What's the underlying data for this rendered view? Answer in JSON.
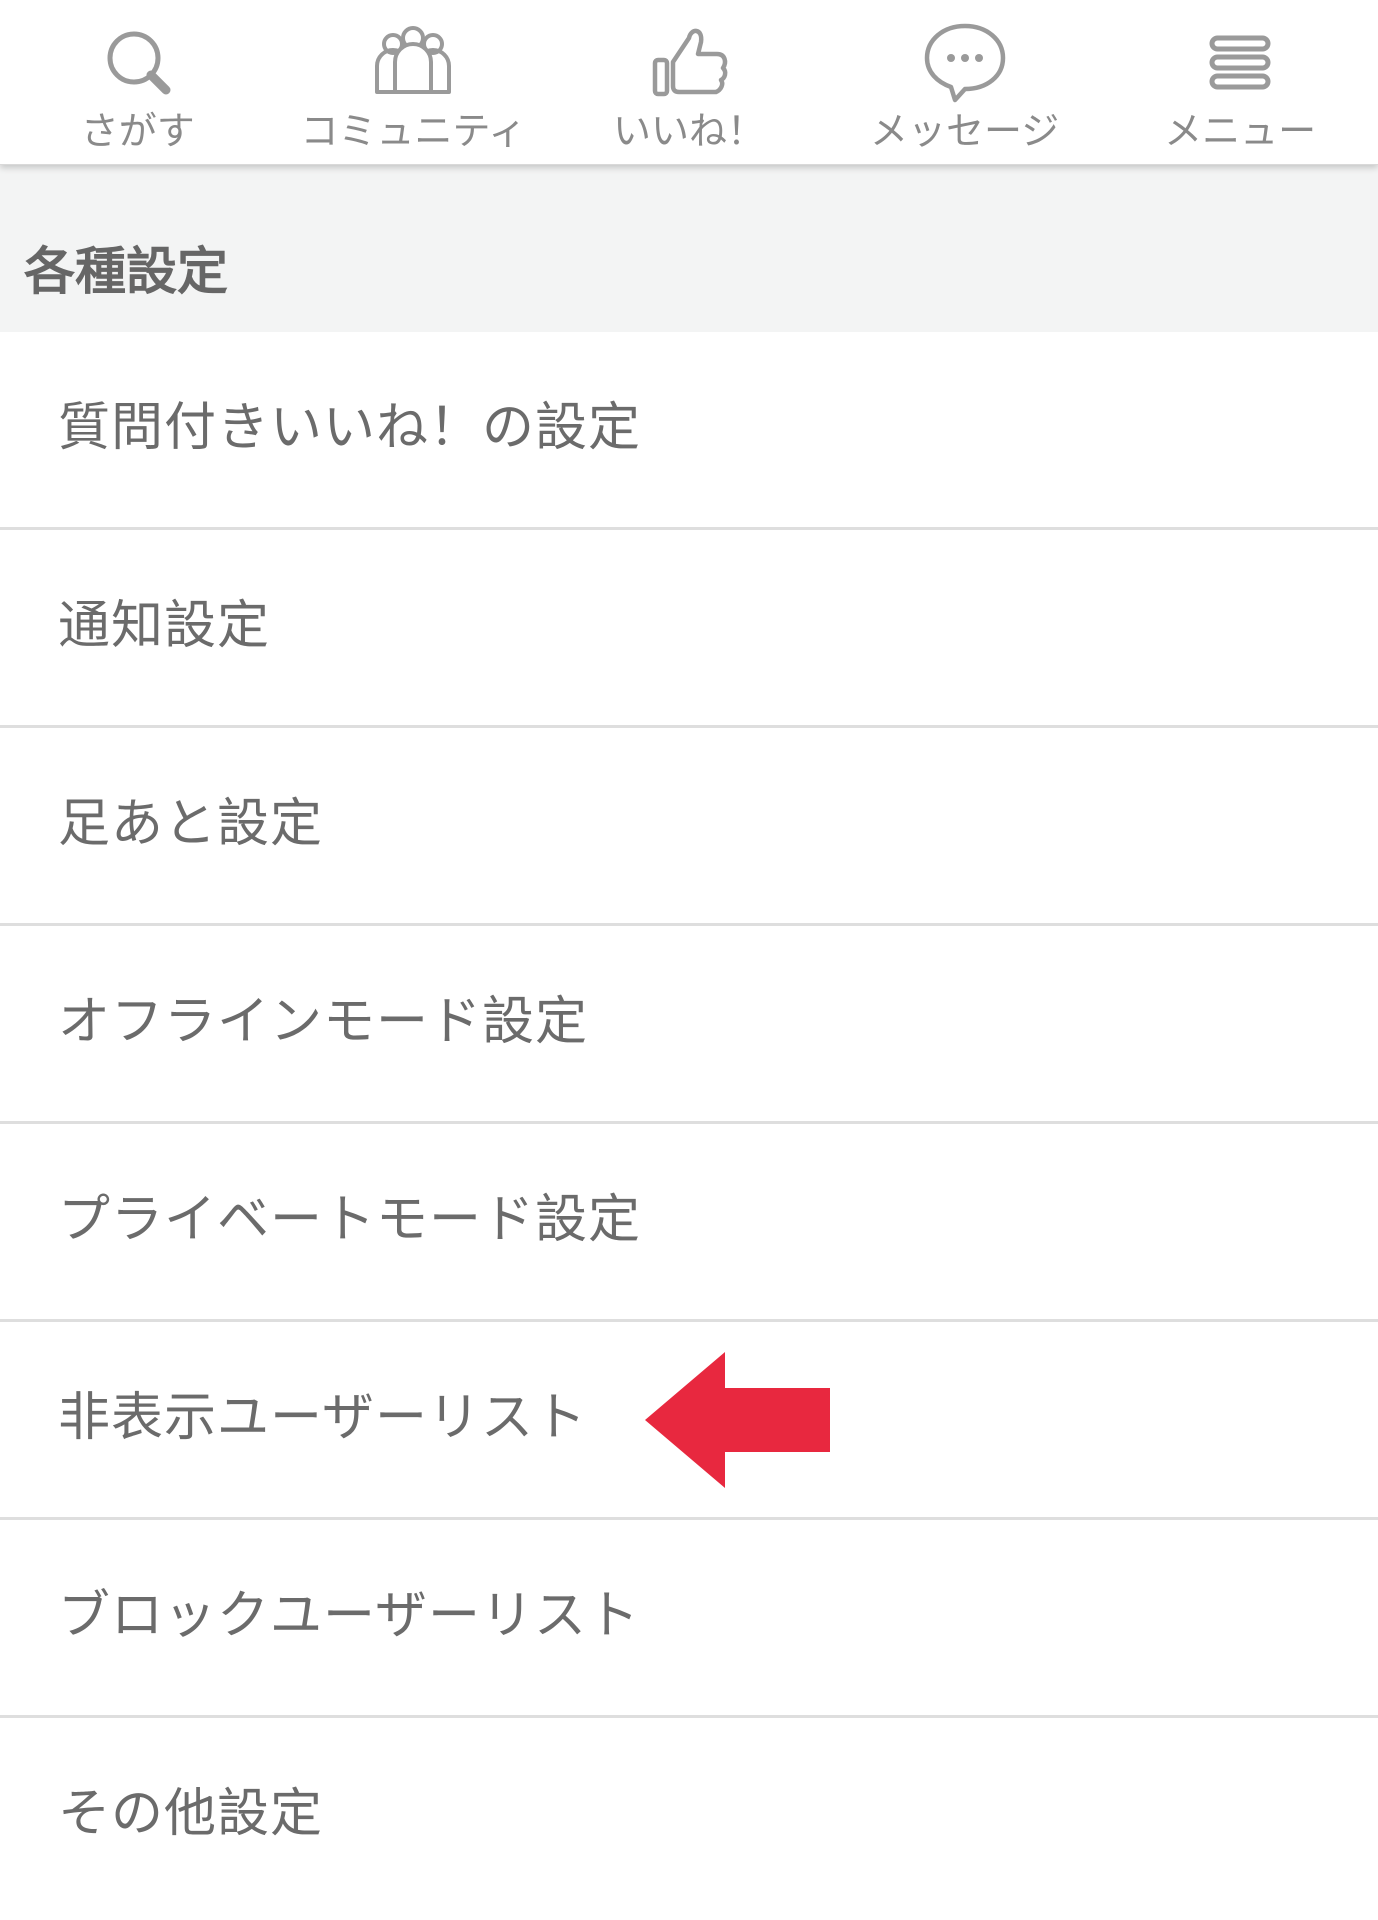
{
  "tabbar": {
    "tabs": [
      {
        "label": "さがす",
        "icon": "search-icon"
      },
      {
        "label": "コミュニティ",
        "icon": "community-icon"
      },
      {
        "label": "いいね！",
        "icon": "thumbs-up-icon"
      },
      {
        "label": "メッセージ",
        "icon": "message-bubble-icon"
      },
      {
        "label": "メニュー",
        "icon": "hamburger-menu-icon"
      }
    ]
  },
  "settings": {
    "section_title": "各種設定",
    "items": [
      {
        "label": "質問付きいいね！の設定"
      },
      {
        "label": "通知設定"
      },
      {
        "label": "足あと設定"
      },
      {
        "label": "オフラインモード設定"
      },
      {
        "label": "プライベートモード設定"
      },
      {
        "label": "非表示ユーザーリスト"
      },
      {
        "label": "ブロックユーザーリスト"
      },
      {
        "label": "その他設定"
      }
    ]
  },
  "annotation": {
    "icon": "red-arrow-left-icon",
    "color": "#e8283f"
  },
  "colors": {
    "icon_gray": "#9a9a9a",
    "text_gray": "#6b6b6b",
    "header_bg": "#f3f4f4",
    "divider": "#dedede"
  }
}
